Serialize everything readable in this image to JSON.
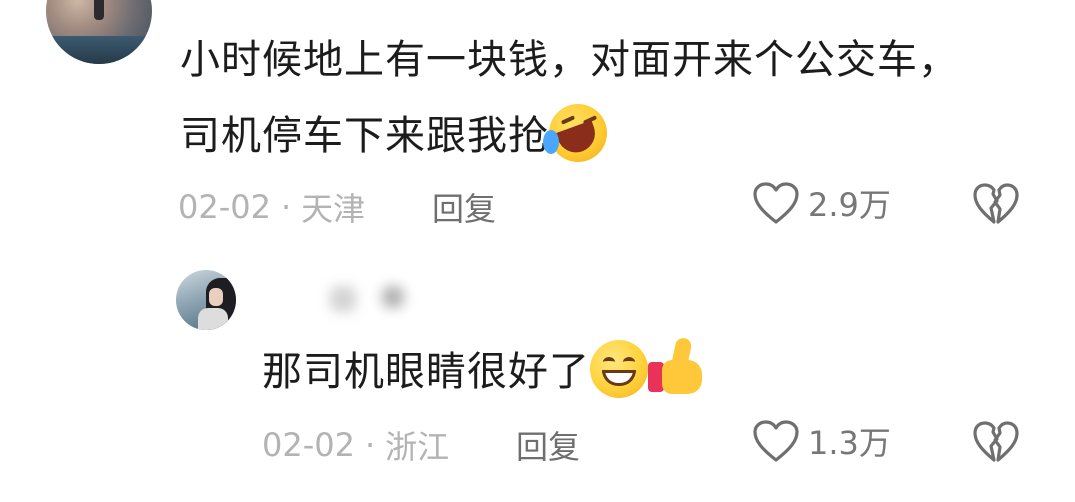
{
  "comments": [
    {
      "text": "小时候地上有一块钱，对面开来个公交车，司机停车下来跟我抢",
      "emoji": "rolling-on-floor-laughing",
      "date": "02-02",
      "location": "天津",
      "reply_label": "回复",
      "likes": "2.9万"
    },
    {
      "text": "那司机眼睛很好了",
      "emoji": [
        "grinning-face",
        "thumbs-up"
      ],
      "date": "02-02",
      "location": "浙江",
      "reply_label": "回复",
      "likes": "1.3万"
    }
  ],
  "icons": {
    "like": "heart-outline-icon",
    "dislike": "broken-heart-icon"
  },
  "colors": {
    "text": "#1c1c1c",
    "meta": "#b3b3b3",
    "action": "#6f6f6f"
  }
}
